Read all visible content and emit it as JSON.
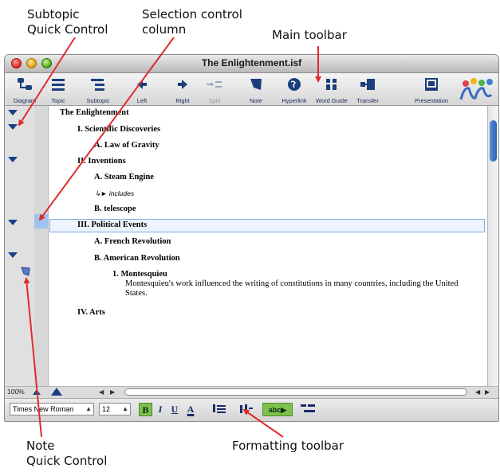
{
  "callouts": {
    "subtopic_quick_control": [
      "Subtopic",
      "Quick Control"
    ],
    "selection_control_column": [
      "Selection control",
      "column"
    ],
    "main_toolbar": "Main toolbar",
    "note_quick_control": [
      "Note",
      "Quick Control"
    ],
    "formatting_toolbar": "Formatting toolbar"
  },
  "window": {
    "title": "The Enlightenment.isf"
  },
  "toolbar": {
    "buttons": [
      {
        "label": "Diagram",
        "icon": "diagram-icon"
      },
      {
        "label": "Topic",
        "icon": "topic-icon"
      },
      {
        "label": "Subtopic",
        "icon": "subtopic-icon"
      },
      {
        "label": "Left",
        "icon": "left-arrow-icon"
      },
      {
        "label": "Right",
        "icon": "right-arrow-icon"
      },
      {
        "label": "Split",
        "icon": "split-icon",
        "disabled": true
      },
      {
        "label": "Note",
        "icon": "note-icon"
      },
      {
        "label": "Hyperlink",
        "icon": "globe-icon"
      },
      {
        "label": "Word Guide",
        "icon": "word-guide-icon"
      },
      {
        "label": "Transfer",
        "icon": "transfer-icon"
      },
      {
        "label": "Presentation",
        "icon": "presentation-icon"
      }
    ]
  },
  "outline": {
    "root": "The Enlightenment",
    "items": [
      {
        "text": "I.  Scientific Discoveries",
        "bold": true
      },
      {
        "text": "A.  Law of Gravity",
        "bold": true
      },
      {
        "text": "II.  Inventions",
        "bold": true
      },
      {
        "text": "A.  Steam Engine",
        "bold": true
      },
      {
        "text": "includes",
        "link": true
      },
      {
        "text": "B.  telescope",
        "bold": true
      },
      {
        "text": "III.  Political Events",
        "bold": true,
        "selected": true
      },
      {
        "text": "A.  French Revolution",
        "bold": true
      },
      {
        "text": "B.  American Revolution",
        "bold": true
      },
      {
        "text": "1.  Montesquieu",
        "bold": true
      },
      {
        "text": "IV.  Arts",
        "bold": true
      }
    ],
    "note": "Montesquieu's work influenced the writing of constitutions in many countries, including the United States."
  },
  "status": {
    "zoom": "100%"
  },
  "formatting": {
    "font": "Times New Roman",
    "size": "12",
    "bold": "B",
    "italic": "I",
    "underline": "U",
    "color": "A",
    "style_label": "abc"
  },
  "colors": {
    "accent": "#163f86",
    "selection": "#9ec3ee",
    "callout_arrow": "#e32a2a",
    "bold_button": "#7dc24e"
  }
}
